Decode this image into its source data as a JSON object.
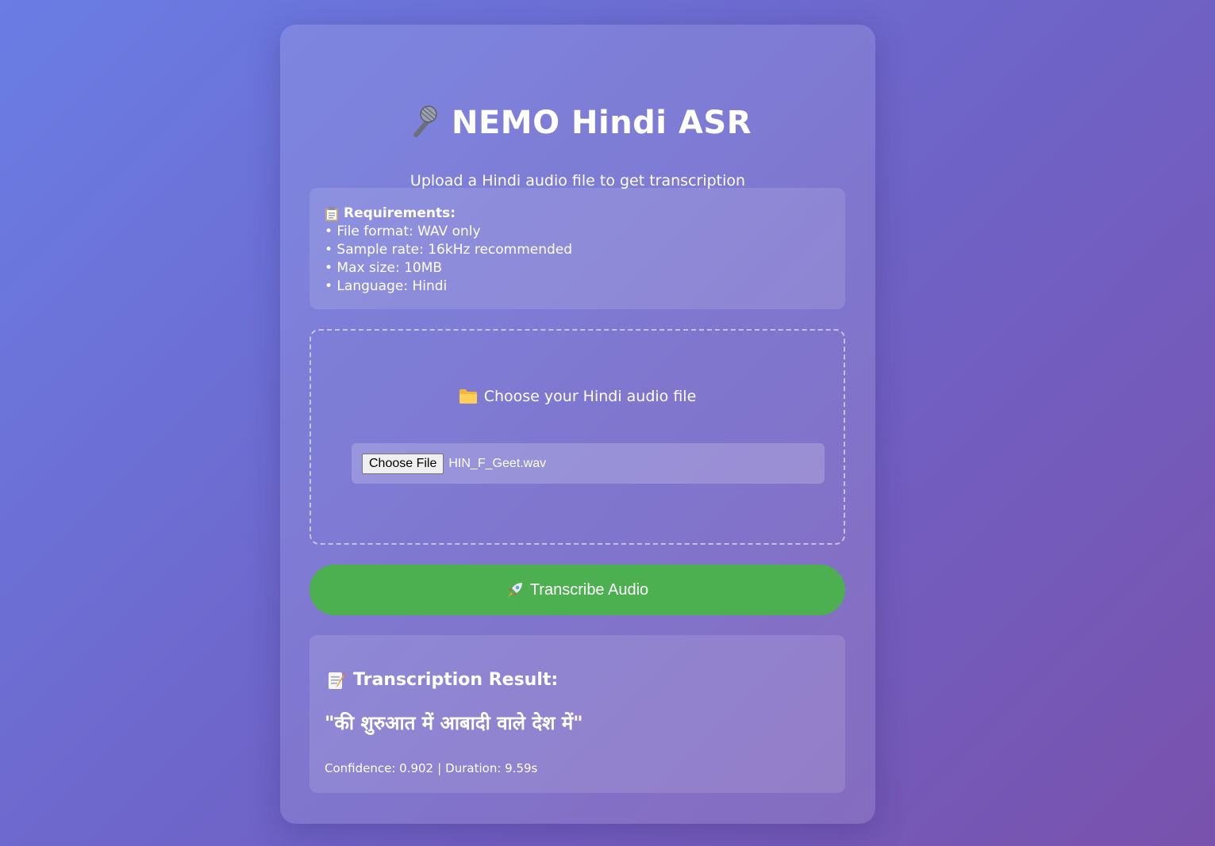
{
  "header": {
    "icon": "microphone-icon",
    "title": "NEMO Hindi ASR",
    "subtitle": "Upload a Hindi audio file to get transcription"
  },
  "requirements": {
    "icon": "clipboard-icon",
    "heading": "Requirements:",
    "items": [
      "• File format: WAV only",
      "• Sample rate: 16kHz recommended",
      "• Max size: 10MB",
      "• Language: Hindi"
    ]
  },
  "upload": {
    "icon": "folder-icon",
    "label": "Choose your Hindi audio file",
    "button_label": "Choose File",
    "file_name": "HIN_F_Geet.wav"
  },
  "action": {
    "icon": "rocket-icon",
    "label": "Transcribe Audio",
    "color": "#4caf50"
  },
  "result": {
    "icon": "memo-icon",
    "heading": "Transcription Result:",
    "text": "\"की शुरुआत में आबादी वाले देश में\"",
    "confidence": "Confidence: 0.902",
    "separator": "|",
    "duration": "Duration: 9.59s"
  }
}
